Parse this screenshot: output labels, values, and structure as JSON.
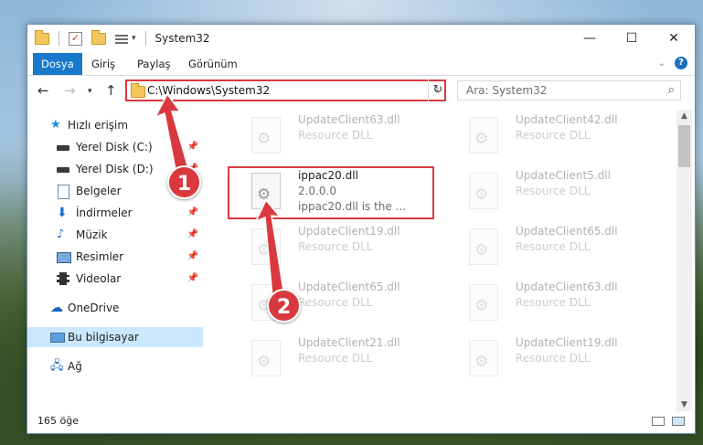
{
  "title_bar": {
    "title": "System32",
    "minimize": "—",
    "maximize": "☐",
    "close": "✕"
  },
  "ribbon": {
    "tabs": [
      "Dosya",
      "Giriş",
      "Paylaş",
      "Görünüm"
    ],
    "active_tab": "Dosya"
  },
  "address": {
    "path": "C:\\Windows\\System32",
    "search_placeholder": "Ara: System32"
  },
  "nav": {
    "quick_access": "Hızlı erişim",
    "items": [
      {
        "label": "Yerel Disk (C:)",
        "icon": "drive-icon",
        "pinned": true
      },
      {
        "label": "Yerel Disk (D:)",
        "icon": "drive-icon",
        "pinned": true
      },
      {
        "label": "Belgeler",
        "icon": "documents-icon",
        "pinned": true
      },
      {
        "label": "İndirmeler",
        "icon": "download-icon",
        "pinned": true
      },
      {
        "label": "Müzik",
        "icon": "music-icon",
        "pinned": true
      },
      {
        "label": "Resimler",
        "icon": "pictures-icon",
        "pinned": true
      },
      {
        "label": "Videolar",
        "icon": "videos-icon",
        "pinned": true
      }
    ],
    "onedrive": "OneDrive",
    "this_pc": "Bu bilgisayar",
    "network": "Ağ"
  },
  "files": {
    "left": [
      {
        "name": "UpdateClient63.dll",
        "desc": "Resource DLL"
      },
      {
        "name": "ippac20.dll",
        "version": "2.0.0.0",
        "desc": "ippac20.dll is the ..."
      },
      {
        "name": "UpdateClient19.dll",
        "desc": "Resource DLL"
      },
      {
        "name": "UpdateClient65.dll",
        "desc": "Resource DLL"
      },
      {
        "name": "UpdateClient21.dll",
        "desc": "Resource DLL"
      }
    ],
    "right": [
      {
        "name": "UpdateClient42.dll",
        "desc": "Resource DLL"
      },
      {
        "name": "UpdateClient5.dll",
        "desc": "Resource DLL"
      },
      {
        "name": "UpdateClient65.dll",
        "desc": "Resource DLL"
      },
      {
        "name": "UpdateClient63.dll",
        "desc": "Resource DLL"
      },
      {
        "name": "UpdateClient19.dll",
        "desc": "Resource DLL"
      }
    ]
  },
  "status": {
    "count": "165 öğe"
  },
  "callouts": {
    "one": "1",
    "two": "2"
  },
  "colors": {
    "accent": "#1979ca",
    "highlight": "#d9393e",
    "selection": "#cce8ff"
  }
}
